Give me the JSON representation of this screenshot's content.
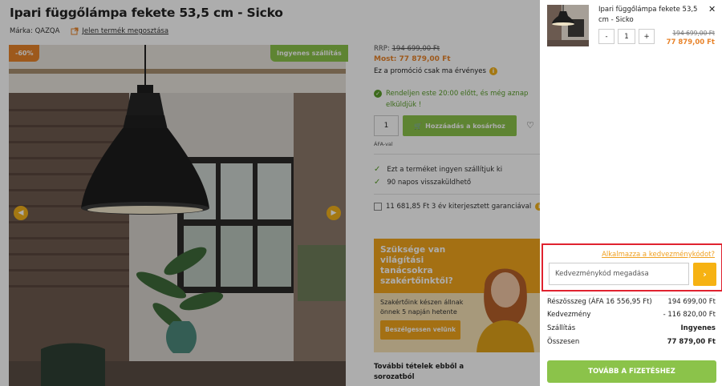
{
  "product": {
    "title": "Ipari függőlámpa fekete 53,5 cm - Sicko",
    "brand": "Márka: QAZQA",
    "share_label": "Jelen termék megosztása",
    "discount_badge": "-60%",
    "shipping_badge": "Ingyenes szállítás",
    "rrp_label": "RRP:",
    "rrp_value": "194 699,00 Ft",
    "now_label": "Most:",
    "now_value": "77 879,00 Ft",
    "promo_note": "Ez a promóció csak ma érvényes",
    "order_note": "Rendeljen este 20:00 előtt, és még aznap elküldjük !",
    "quantity": "1",
    "add_to_cart": "Hozzáadás a kosárhoz",
    "vat_note": "ÁFA-val",
    "features": [
      "Ezt a terméket ingyen szállítjuk ki",
      "90 napos visszaküldhető"
    ],
    "warranty": "11 681,85 Ft 3 év kiterjesztett garanciával"
  },
  "advice": {
    "title": "Szüksége van világítási tanácsokra szakértőinktől?",
    "body": "Szakértőink készen állnak önnek 5 napján hetente",
    "button": "Beszélgessen velünk"
  },
  "more_items": "További tételek ebből a sorozatból",
  "cart": {
    "item_name": "Ipari függőlámpa fekete 53,5 cm - Sicko",
    "minus": "-",
    "plus": "+",
    "quantity": "1",
    "old_price": "194 699,00 Ft",
    "new_price": "77 879,00 Ft",
    "coupon_link": "Alkalmazza a kedvezménykódot?",
    "coupon_placeholder": "Kedvezménykód megadása",
    "summary": [
      {
        "label": "Részösszeg (ÁFA 16 556,95 Ft)",
        "value": "194 699,00 Ft"
      },
      {
        "label": "Kedvezmény",
        "value": "- 116 820,00 Ft"
      },
      {
        "label": "Szállítás",
        "value": "Ingyenes"
      },
      {
        "label": "Összesen",
        "value": "77 879,00 Ft"
      }
    ],
    "checkout": "TOVÁBB A FIZETÉSHEZ"
  },
  "colors": {
    "accent_orange": "#e8832a",
    "accent_green": "#8bc34a",
    "coupon_button": "#f6b213",
    "highlight_border": "#e0222f"
  }
}
